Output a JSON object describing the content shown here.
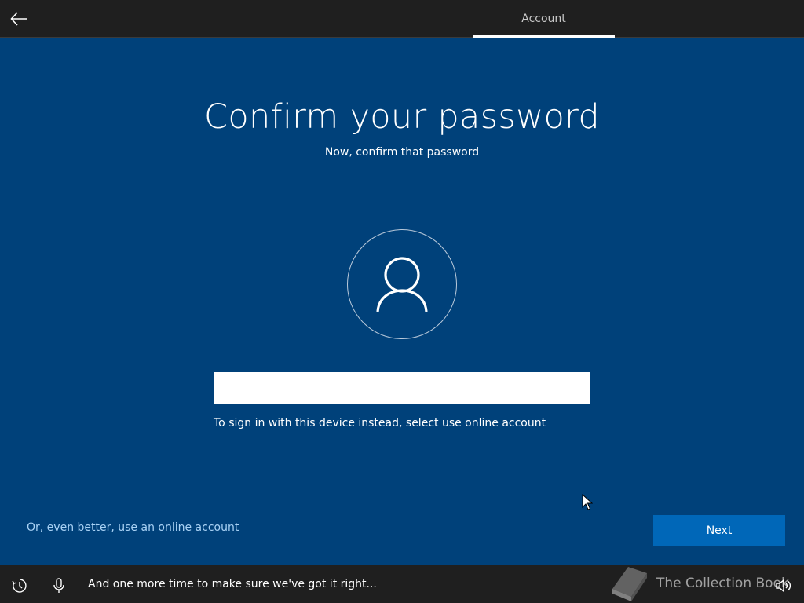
{
  "header": {
    "back_icon": "back-arrow-icon",
    "tab_label": "Account"
  },
  "main": {
    "title": "Confirm your password",
    "subtitle": "Now, confirm that password",
    "avatar_icon": "user-icon",
    "password": {
      "value": "",
      "placeholder": ""
    },
    "hint": "To sign in with this device instead, select use online account"
  },
  "footer_actions": {
    "online_account_link": "Or, even better, use an online account",
    "next_label": "Next"
  },
  "taskbar": {
    "ease_icon": "ease-of-access-icon",
    "mic_icon": "microphone-icon",
    "caption": "And one more time to make sure we've got it right...",
    "volume_icon": "volume-icon",
    "watermark_text": "The Collection Book"
  },
  "colors": {
    "background": "#00417a",
    "bar": "#1f1f1f",
    "button": "#0067b8",
    "link": "#a9d2f5"
  }
}
